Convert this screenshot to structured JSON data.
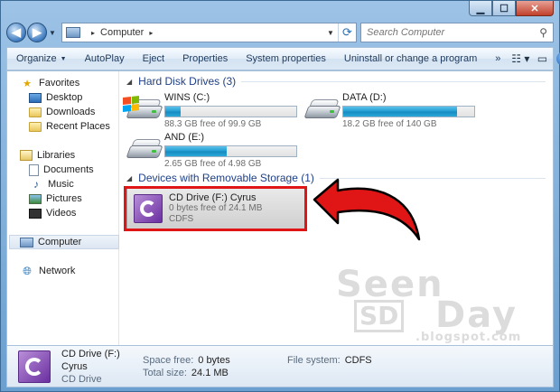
{
  "window": {
    "title_buttons": [
      "minimize",
      "maximize",
      "close"
    ]
  },
  "address": {
    "root": "Computer",
    "path_separator": "▸"
  },
  "search": {
    "placeholder": "Search Computer"
  },
  "toolbar": {
    "items": [
      "Organize",
      "AutoPlay",
      "Eject",
      "Properties",
      "System properties",
      "Uninstall or change a program"
    ],
    "more": "»"
  },
  "sidebar": {
    "favorites": "Favorites",
    "favorites_items": [
      "Desktop",
      "Downloads",
      "Recent Places"
    ],
    "libraries": "Libraries",
    "libraries_items": [
      "Documents",
      "Music",
      "Pictures",
      "Videos"
    ],
    "computer": "Computer",
    "network": "Network"
  },
  "groups": {
    "hdd": "Hard Disk Drives (3)",
    "removable": "Devices with Removable Storage (1)"
  },
  "drives": [
    {
      "name": "WINS (C:)",
      "free": "88.3 GB free of 99.9 GB",
      "used_fraction": 0.116,
      "system": true
    },
    {
      "name": "DATA (D:)",
      "free": "18.2 GB free of 140 GB",
      "used_fraction": 0.87,
      "system": false
    },
    {
      "name": "AND (E:)",
      "free": "2.65 GB free of 4.98 GB",
      "used_fraction": 0.468,
      "system": false
    }
  ],
  "cd": {
    "name": "CD Drive (F:) Cyrus",
    "free": "0 bytes free of 24.1 MB",
    "fs": "CDFS"
  },
  "details": {
    "name": "CD Drive (F:) Cyrus",
    "type": "CD Drive",
    "space_free_label": "Space free:",
    "space_free": "0 bytes",
    "total_size_label": "Total size:",
    "total_size": "24.1 MB",
    "fs_label": "File system:",
    "fs": "CDFS"
  },
  "watermark": {
    "line1": "Seen",
    "badge": "SD",
    "line2": "Day",
    "line3": ".blogspot.com"
  },
  "colors": {
    "accent": "#1e3f87",
    "highlight": "#e01515",
    "bar_fill": "#1f9ad0"
  }
}
